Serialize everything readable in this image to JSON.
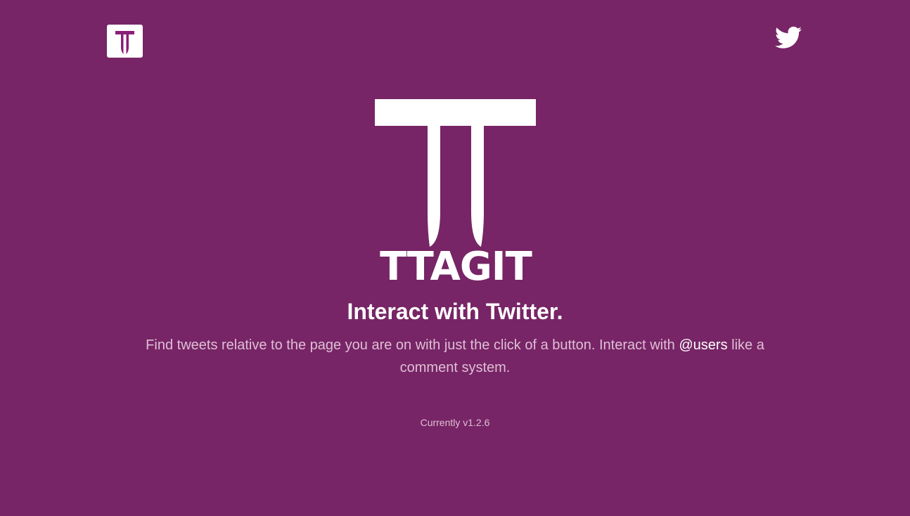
{
  "header": {
    "logo_icon": "ttagit-t-logo-icon",
    "twitter_icon": "twitter-bird-icon"
  },
  "hero": {
    "mark_icon": "ttagit-large-t-mark-icon",
    "wordmark": "TTAGIT",
    "headline": "Interact with Twitter.",
    "description_before": "Find tweets relative to the page you are on with just the click of a button. Interact with ",
    "users_link": "@users",
    "description_after": " like a comment system."
  },
  "footer": {
    "version": "Currently v1.2.6"
  },
  "colors": {
    "background": "#772566",
    "accent": "#8a1e78",
    "text_primary": "#ffffff",
    "text_muted": "#e0bfd6"
  }
}
